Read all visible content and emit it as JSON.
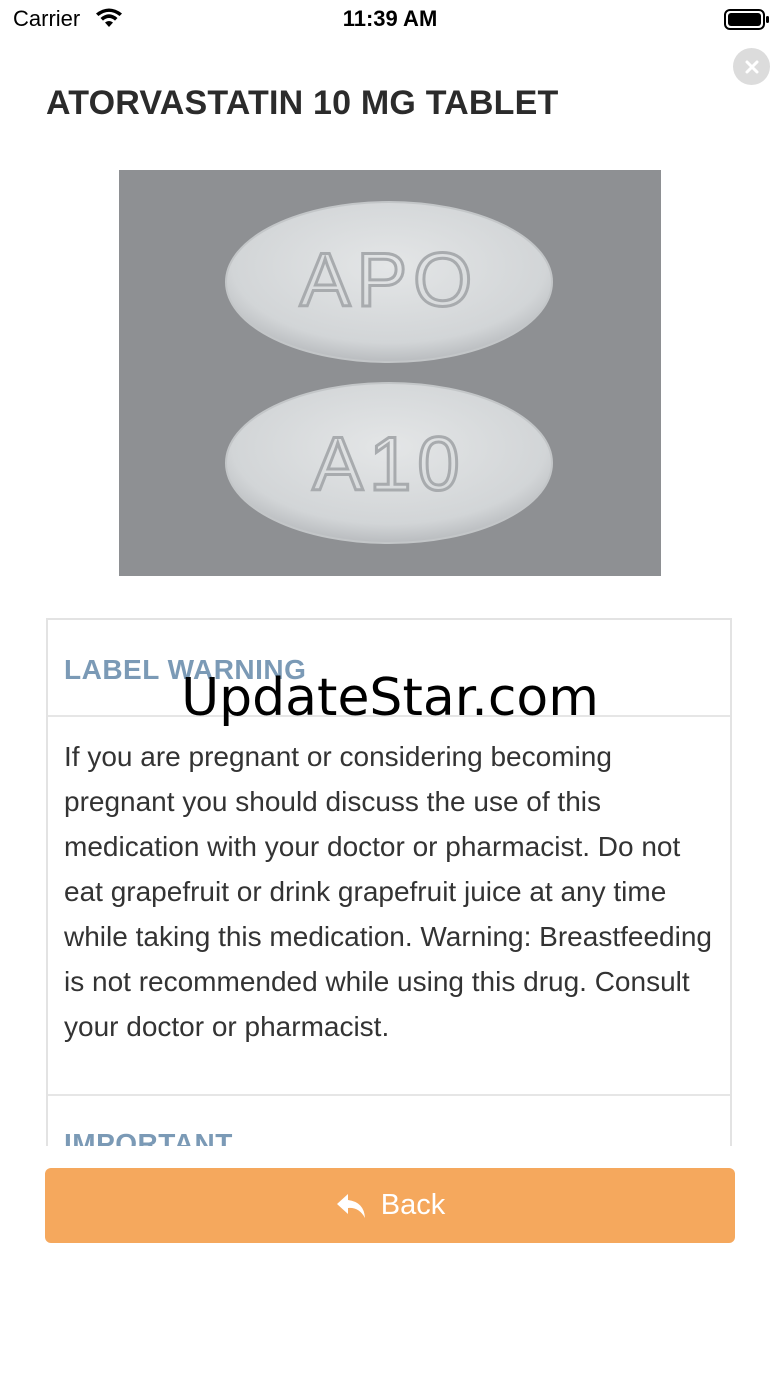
{
  "status_bar": {
    "carrier": "Carrier",
    "time": "11:39 AM"
  },
  "header": {
    "title": "ATORVASTATIN 10 MG TABLET",
    "close_icon": "close-icon"
  },
  "pill_image": {
    "imprint_top": "APO",
    "imprint_bottom": "A10",
    "background": "#8e9093"
  },
  "sections": [
    {
      "heading": "LABEL WARNING",
      "body": "If you are pregnant or considering becoming pregnant you should discuss the use of this medication with your doctor or pharmacist. Do not eat grapefruit or drink grapefruit juice at any time while taking this medication. Warning: Breastfeeding is not recommended while using this drug. Consult your doctor or pharmacist."
    },
    {
      "heading": "IMPORTANT"
    }
  ],
  "watermark": "UpdateStar.com",
  "back_button": {
    "label": "Back",
    "icon": "reply-icon",
    "color": "#f5a85d"
  },
  "colors": {
    "heading": "#7b9ab6",
    "accent": "#f5a85d"
  }
}
